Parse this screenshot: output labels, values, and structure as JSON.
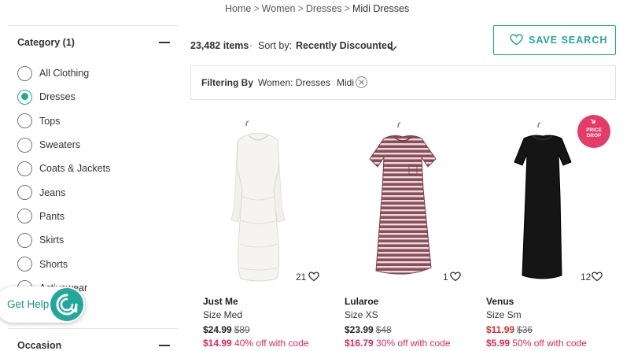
{
  "breadcrumb": {
    "items": [
      "Home",
      "Women",
      "Dresses"
    ],
    "current": "Midi Dresses",
    "separator": ">"
  },
  "sidebar": {
    "category_title": "Category (1)",
    "categories": [
      {
        "label": "All Clothing",
        "selected": false
      },
      {
        "label": "Dresses",
        "selected": true
      },
      {
        "label": "Tops",
        "selected": false
      },
      {
        "label": "Sweaters",
        "selected": false
      },
      {
        "label": "Coats & Jackets",
        "selected": false
      },
      {
        "label": "Jeans",
        "selected": false
      },
      {
        "label": "Pants",
        "selected": false
      },
      {
        "label": "Skirts",
        "selected": false
      },
      {
        "label": "Shorts",
        "selected": false
      },
      {
        "label": "Activewear",
        "selected": false
      }
    ],
    "occasion_title": "Occasion"
  },
  "help": {
    "label": "Get Help"
  },
  "results": {
    "count": "23,482 items",
    "dot": "·",
    "sort_label": "Sort by:",
    "sort_value": "Recently Discounted"
  },
  "save_search": {
    "label": "SAVE SEARCH"
  },
  "filters": {
    "title": "Filtering By",
    "chips": [
      "Women: Dresses",
      "Midi"
    ]
  },
  "badge": {
    "line1": "PRICE",
    "line2": "DROP"
  },
  "colors": {
    "accent": "#22a89a",
    "sale_red": "#e0292e",
    "promo_pink": "#e0295e",
    "badge_pink": "#e63a67"
  },
  "products": [
    {
      "brand": "Just Me",
      "size": "Size Med",
      "price": "$24.99",
      "original": "$89",
      "promo_price": "$14.99",
      "promo_text": "40% off with code",
      "likes": "21",
      "dress": "white-lace-dress"
    },
    {
      "brand": "Lularoe",
      "size": "Size XS",
      "price": "$23.99",
      "original": "$48",
      "promo_price": "$16.79",
      "promo_text": "30% off with code",
      "likes": "1",
      "dress": "striped-tshirt-dress"
    },
    {
      "brand": "Venus",
      "size": "Size Sm",
      "price": "$11.99",
      "original": "$36",
      "promo_price": "$5.99",
      "promo_text": "50% off with code",
      "likes": "12",
      "dress": "black-bodycon-dress",
      "price_drop": true
    }
  ]
}
